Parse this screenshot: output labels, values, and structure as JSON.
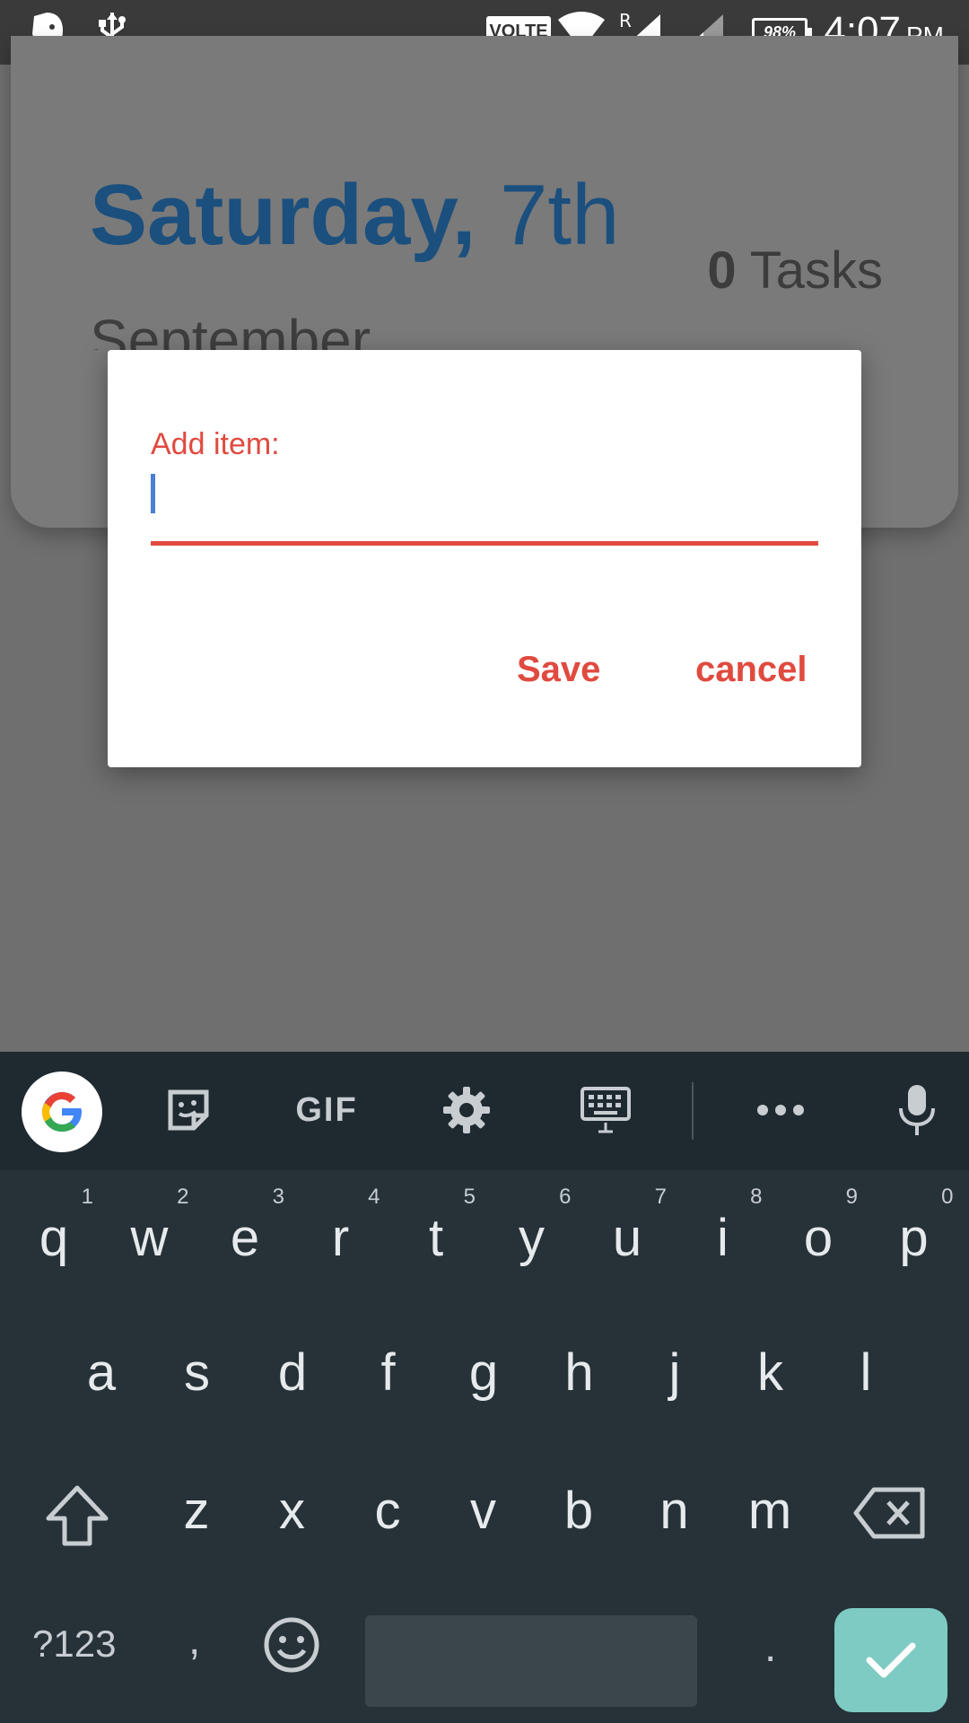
{
  "status_bar": {
    "time": "4:07",
    "ampm": "PM",
    "volte": "VOLTE",
    "battery": "98%",
    "icons": [
      "evernote-icon",
      "usb-icon",
      "wifi-icon",
      "signal-sim1-icon",
      "signal-sim2-icon",
      "battery-icon"
    ]
  },
  "card": {
    "day_name": "Saturday,",
    "day_number": "7th",
    "month": "September",
    "tasks_count": "0",
    "tasks_label": "Tasks"
  },
  "dialog": {
    "label": "Add item:",
    "input_value": "",
    "save": "Save",
    "cancel": "cancel"
  },
  "keyboard": {
    "toolbar": [
      "google-icon",
      "sticker-icon",
      "GIF",
      "settings-icon",
      "keyboard-layout-icon",
      "more-icon",
      "mic-icon"
    ],
    "gif_label": "GIF",
    "row1": [
      {
        "k": "q",
        "n": "1"
      },
      {
        "k": "w",
        "n": "2"
      },
      {
        "k": "e",
        "n": "3"
      },
      {
        "k": "r",
        "n": "4"
      },
      {
        "k": "t",
        "n": "5"
      },
      {
        "k": "y",
        "n": "6"
      },
      {
        "k": "u",
        "n": "7"
      },
      {
        "k": "i",
        "n": "8"
      },
      {
        "k": "o",
        "n": "9"
      },
      {
        "k": "p",
        "n": "0"
      }
    ],
    "row2": [
      "a",
      "s",
      "d",
      "f",
      "g",
      "h",
      "j",
      "k",
      "l"
    ],
    "row3": [
      "z",
      "x",
      "c",
      "v",
      "b",
      "n",
      "m"
    ],
    "symbols_label": "?123",
    "comma": ",",
    "period": ".",
    "colors": {
      "accent": "#e04a3f",
      "enter_bg": "#7ecbc4",
      "keyboard_bg": "#263238"
    }
  }
}
